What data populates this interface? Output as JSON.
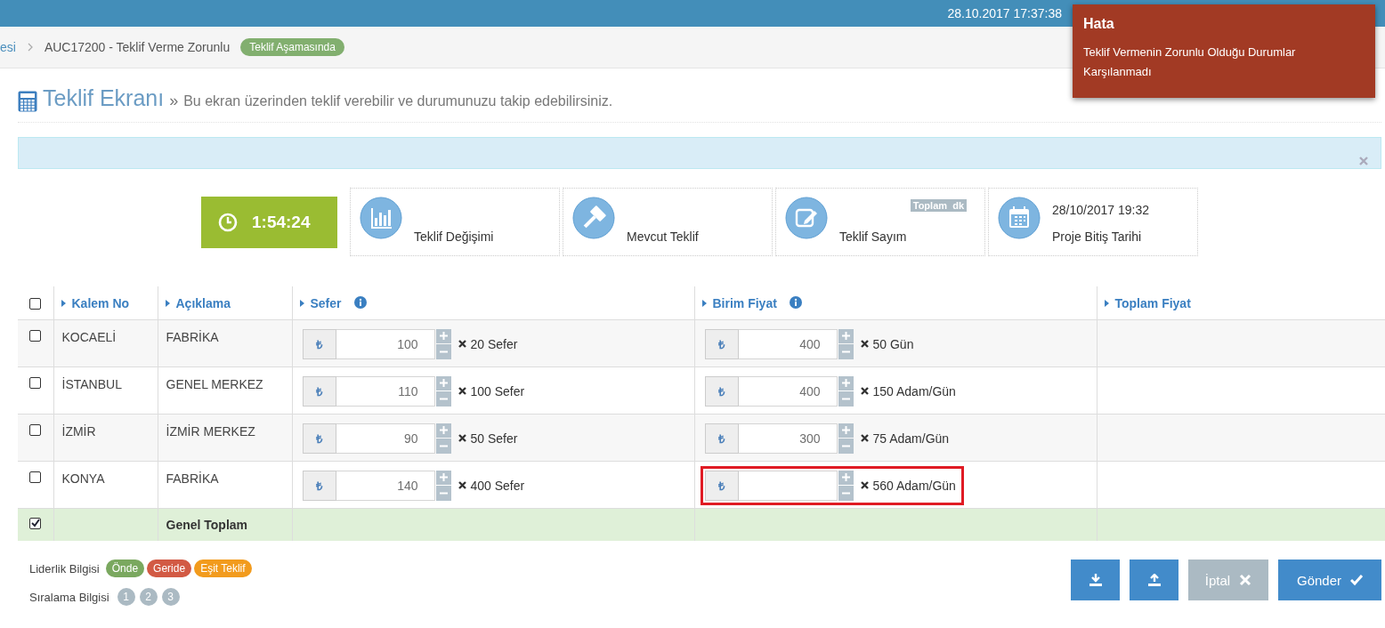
{
  "header": {
    "datetime": "28.10.2017 17:37:38"
  },
  "breadcrumb": {
    "items": [
      "esi",
      "AUC17200 - Teklif Verme Zorunlu"
    ],
    "status_badge": "Teklif Aşamasında"
  },
  "page_title": {
    "title": "Teklif Ekranı",
    "separator": "»",
    "subtitle": "Bu ekran üzerinden teklif verebilir ve durumunuzu takip edebilirsiniz."
  },
  "timer": "1:54:24",
  "stats": [
    {
      "kind": "chart",
      "label": "Teklif Değişimi"
    },
    {
      "kind": "gavel",
      "label": "Mevcut Teklif"
    },
    {
      "kind": "edit",
      "label": "Teklif Sayım",
      "badge": "Toplam  dk"
    },
    {
      "kind": "calendar",
      "label": "Proje Bitiş Tarihi",
      "value": "28/10/2017 19:32"
    }
  ],
  "table": {
    "select_all": {
      "checked": false
    },
    "columns": [
      {
        "label": "Kalem No",
        "info": false
      },
      {
        "label": "Açıklama",
        "info": false
      },
      {
        "label": "Sefer",
        "info": true
      },
      {
        "label": "Birim Fiyat",
        "info": true
      },
      {
        "label": "Toplam Fiyat",
        "info": false
      }
    ],
    "rows": [
      {
        "checked": false,
        "kalem_no": "KOCAELİ",
        "aciklama": "FABRİKA",
        "sefer": {
          "currency": "₺",
          "value": "100",
          "quantity": "20 Sefer",
          "highlighted": false
        },
        "birim_fiyat": {
          "currency": "₺",
          "value": "400",
          "quantity": "50 Gün",
          "highlighted": false
        }
      },
      {
        "checked": false,
        "kalem_no": "İSTANBUL",
        "aciklama": "GENEL MERKEZ",
        "sefer": {
          "currency": "₺",
          "value": "110",
          "quantity": "100 Sefer",
          "highlighted": false
        },
        "birim_fiyat": {
          "currency": "₺",
          "value": "400",
          "quantity": "150 Adam/Gün",
          "highlighted": false
        }
      },
      {
        "checked": false,
        "kalem_no": "İZMİR",
        "aciklama": "İZMİR MERKEZ",
        "sefer": {
          "currency": "₺",
          "value": "90",
          "quantity": "50 Sefer",
          "highlighted": false
        },
        "birim_fiyat": {
          "currency": "₺",
          "value": "300",
          "quantity": "75 Adam/Gün",
          "highlighted": false
        }
      },
      {
        "checked": false,
        "kalem_no": "KONYA",
        "aciklama": "FABRİKA",
        "sefer": {
          "currency": "₺",
          "value": "140",
          "quantity": "400 Sefer",
          "highlighted": false
        },
        "birim_fiyat": {
          "currency": "₺",
          "quantity": "560 Adam/Gün",
          "highlighted": true
        }
      }
    ],
    "total_row": {
      "checked": true,
      "label": "Genel Toplam"
    }
  },
  "legend": {
    "leadership": {
      "label": "Liderlik Bilgisi",
      "badges": [
        {
          "text": "Önde",
          "color": "#7aa85f"
        },
        {
          "text": "Geride",
          "color": "#d25a44"
        },
        {
          "text": "Eşit Teklif",
          "color": "#f29b1d"
        }
      ]
    },
    "ranking": {
      "label": "Sıralama Bilgisi",
      "badges": [
        "1",
        "2",
        "3"
      ]
    }
  },
  "actions": [
    {
      "kind": "download",
      "disabled": false
    },
    {
      "kind": "upload",
      "disabled": false
    },
    {
      "kind": "cancel",
      "label": "İptal",
      "disabled": true
    },
    {
      "kind": "send",
      "label": "Gönder",
      "disabled": false
    }
  ],
  "toast": {
    "title": "Hata",
    "message": "Teklif Vermenin Zorunlu Olduğu Durumlar Karşılanmadı"
  }
}
